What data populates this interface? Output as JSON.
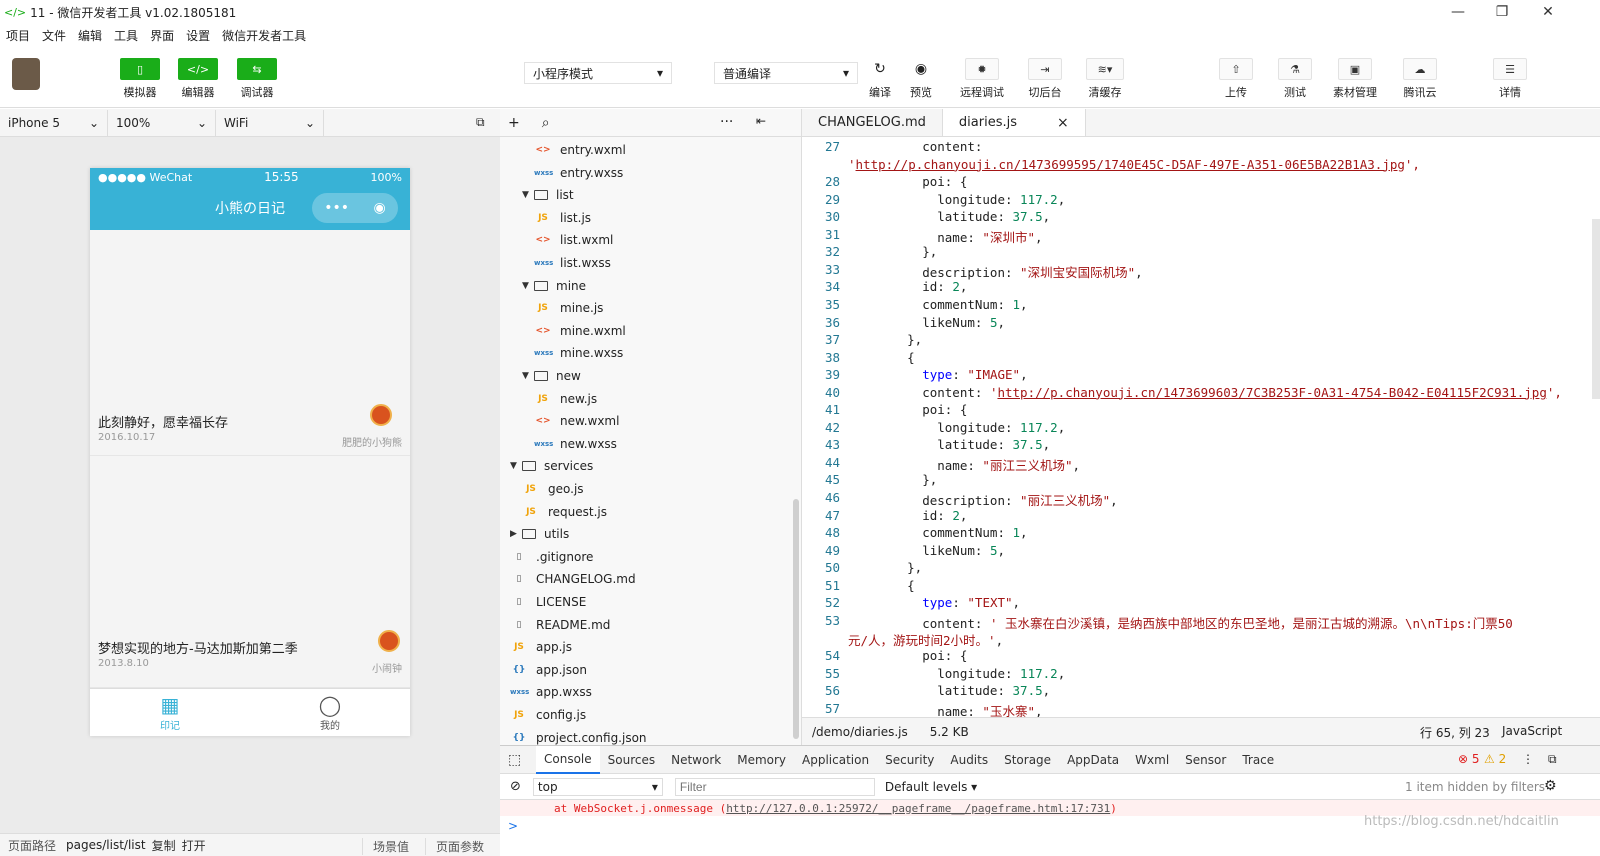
{
  "window": {
    "title": "11 - 微信开发者工具 v1.02.1805181",
    "minimize": "—",
    "maximize": "❐",
    "close": "✕"
  },
  "menu": [
    "项目",
    "文件",
    "编辑",
    "工具",
    "界面",
    "设置",
    "微信开发者工具"
  ],
  "toolbar": {
    "simulator": "模拟器",
    "editor": "编辑器",
    "debugger": "调试器",
    "mode_select": "小程序模式",
    "compile_select": "普通编译",
    "compile": "编译",
    "preview": "预览",
    "remote_debug": "远程调试",
    "background": "切后台",
    "clear_cache": "清缓存",
    "upload": "上传",
    "test": "测试",
    "assets": "素材管理",
    "tencent_cloud": "腾讯云",
    "details": "详情"
  },
  "device": {
    "model": "iPhone 5",
    "zoom": "100%",
    "network": "WiFi"
  },
  "phone": {
    "carrier": "●●●●● WeChat",
    "time": "15:55",
    "battery": "100%",
    "nav_title": "小熊の日记",
    "capsule_more": "•••",
    "capsule_close": "◉",
    "diaries": [
      {
        "title": "此刻静好，愿幸福长存",
        "date": "2016.10.17",
        "author": "肥肥的小狗熊"
      },
      {
        "title": "梦想实现的地方-马达加斯加第二季",
        "date": "2013.8.10",
        "author": "小闹钟"
      }
    ],
    "tabs": [
      {
        "label": "印记"
      },
      {
        "label": "我的"
      }
    ]
  },
  "bottom": {
    "path_label": "页面路径",
    "path": "pages/list/list",
    "copy": "复制",
    "open": "打开",
    "scene": "场景值",
    "params": "页面参数"
  },
  "tree": {
    "add": "+",
    "search": "⌕",
    "more": "···",
    "collapse": "⇤",
    "rows": [
      {
        "kind": "wxml",
        "name": "entry.wxml",
        "ft": "<>",
        "indent": 2
      },
      {
        "kind": "wxss",
        "name": "entry.wxss",
        "ft": "wxss",
        "indent": 2
      },
      {
        "kind": "folder",
        "name": "list",
        "ft": "",
        "indent": 1,
        "caret": "▼"
      },
      {
        "kind": "js",
        "name": "list.js",
        "ft": "JS",
        "indent": 2
      },
      {
        "kind": "wxml",
        "name": "list.wxml",
        "ft": "<>",
        "indent": 2
      },
      {
        "kind": "wxss",
        "name": "list.wxss",
        "ft": "wxss",
        "indent": 2
      },
      {
        "kind": "folder",
        "name": "mine",
        "ft": "",
        "indent": 1,
        "caret": "▼"
      },
      {
        "kind": "js",
        "name": "mine.js",
        "ft": "JS",
        "indent": 2
      },
      {
        "kind": "wxml",
        "name": "mine.wxml",
        "ft": "<>",
        "indent": 2
      },
      {
        "kind": "wxss",
        "name": "mine.wxss",
        "ft": "wxss",
        "indent": 2
      },
      {
        "kind": "folder",
        "name": "new",
        "ft": "",
        "indent": 1,
        "caret": "▼"
      },
      {
        "kind": "js",
        "name": "new.js",
        "ft": "JS",
        "indent": 2
      },
      {
        "kind": "wxml",
        "name": "new.wxml",
        "ft": "<>",
        "indent": 2
      },
      {
        "kind": "wxss",
        "name": "new.wxss",
        "ft": "wxss",
        "indent": 2
      },
      {
        "kind": "folder",
        "name": "services",
        "ft": "",
        "indent": 0,
        "caret": "▼"
      },
      {
        "kind": "js",
        "name": "geo.js",
        "ft": "JS",
        "indent": 1
      },
      {
        "kind": "js",
        "name": "request.js",
        "ft": "JS",
        "indent": 1
      },
      {
        "kind": "folder",
        "name": "utils",
        "ft": "",
        "indent": 0,
        "caret": "▶"
      },
      {
        "kind": "file",
        "name": ".gitignore",
        "ft": "▯",
        "indent": 0
      },
      {
        "kind": "file",
        "name": "CHANGELOG.md",
        "ft": "▯",
        "indent": 0
      },
      {
        "kind": "file",
        "name": "LICENSE",
        "ft": "▯",
        "indent": 0
      },
      {
        "kind": "file",
        "name": "README.md",
        "ft": "▯",
        "indent": 0
      },
      {
        "kind": "js",
        "name": "app.js",
        "ft": "JS",
        "indent": 0
      },
      {
        "kind": "json",
        "name": "app.json",
        "ft": "{}",
        "indent": 0
      },
      {
        "kind": "wxss",
        "name": "app.wxss",
        "ft": "wxss",
        "indent": 0
      },
      {
        "kind": "js",
        "name": "config.js",
        "ft": "JS",
        "indent": 0
      },
      {
        "kind": "json",
        "name": "project.config.json",
        "ft": "{}",
        "indent": 0
      }
    ]
  },
  "editor": {
    "tabs": [
      {
        "label": "CHANGELOG.md"
      },
      {
        "label": "diaries.js",
        "active": true,
        "close": "×"
      }
    ],
    "lines": [
      {
        "n": "27",
        "parts": [
          [
            "",
            "        content: "
          ]
        ]
      },
      {
        "n": "",
        "parts": [
          [
            "s",
            "'"
          ],
          [
            "u",
            "http://p.chanyouji.cn/1473699595/1740E45C-D5AF-497E-A351-06E5BA22B1A3.jpg"
          ],
          [
            "s",
            "',"
          ]
        ]
      },
      {
        "n": "28",
        "parts": [
          [
            "",
            "        poi: {"
          ]
        ]
      },
      {
        "n": "29",
        "parts": [
          [
            "",
            "          longitude: "
          ],
          [
            "n",
            "117.2"
          ],
          [
            "",
            ","
          ]
        ]
      },
      {
        "n": "30",
        "parts": [
          [
            "",
            "          latitude: "
          ],
          [
            "n",
            "37.5"
          ],
          [
            "",
            ","
          ]
        ]
      },
      {
        "n": "31",
        "parts": [
          [
            "",
            "          name: "
          ],
          [
            "s",
            "\"深圳市\""
          ],
          [
            "",
            ","
          ]
        ]
      },
      {
        "n": "32",
        "parts": [
          [
            "",
            "        },"
          ]
        ]
      },
      {
        "n": "33",
        "parts": [
          [
            "",
            "        description: "
          ],
          [
            "s",
            "\"深圳宝安国际机场\""
          ],
          [
            "",
            ","
          ]
        ]
      },
      {
        "n": "34",
        "parts": [
          [
            "",
            "        id: "
          ],
          [
            "n",
            "2"
          ],
          [
            "",
            ","
          ]
        ]
      },
      {
        "n": "35",
        "parts": [
          [
            "",
            "        commentNum: "
          ],
          [
            "n",
            "1"
          ],
          [
            "",
            ","
          ]
        ]
      },
      {
        "n": "36",
        "parts": [
          [
            "",
            "        likeNum: "
          ],
          [
            "n",
            "5"
          ],
          [
            "",
            ","
          ]
        ]
      },
      {
        "n": "37",
        "parts": [
          [
            "",
            "      },"
          ]
        ]
      },
      {
        "n": "38",
        "parts": [
          [
            "",
            "      {"
          ]
        ]
      },
      {
        "n": "39",
        "parts": [
          [
            "",
            "        "
          ],
          [
            "k",
            "type"
          ],
          [
            "",
            ": "
          ],
          [
            "s",
            "\"IMAGE\""
          ],
          [
            "",
            ","
          ]
        ]
      },
      {
        "n": "40",
        "parts": [
          [
            "",
            "        content: "
          ],
          [
            "s",
            "'"
          ],
          [
            "u",
            "http://p.chanyouji.cn/1473699603/7C3B253F-0A31-4754-B042-E04115F2C931.jpg"
          ],
          [
            "s",
            "',"
          ]
        ]
      },
      {
        "n": "41",
        "parts": [
          [
            "",
            "        poi: {"
          ]
        ]
      },
      {
        "n": "42",
        "parts": [
          [
            "",
            "          longitude: "
          ],
          [
            "n",
            "117.2"
          ],
          [
            "",
            ","
          ]
        ]
      },
      {
        "n": "43",
        "parts": [
          [
            "",
            "          latitude: "
          ],
          [
            "n",
            "37.5"
          ],
          [
            "",
            ","
          ]
        ]
      },
      {
        "n": "44",
        "parts": [
          [
            "",
            "          name: "
          ],
          [
            "s",
            "\"丽江三义机场\""
          ],
          [
            "",
            ","
          ]
        ]
      },
      {
        "n": "45",
        "parts": [
          [
            "",
            "        },"
          ]
        ]
      },
      {
        "n": "46",
        "parts": [
          [
            "",
            "        description: "
          ],
          [
            "s",
            "\"丽江三义机场\""
          ],
          [
            "",
            ","
          ]
        ]
      },
      {
        "n": "47",
        "parts": [
          [
            "",
            "        id: "
          ],
          [
            "n",
            "2"
          ],
          [
            "",
            ","
          ]
        ]
      },
      {
        "n": "48",
        "parts": [
          [
            "",
            "        commentNum: "
          ],
          [
            "n",
            "1"
          ],
          [
            "",
            ","
          ]
        ]
      },
      {
        "n": "49",
        "parts": [
          [
            "",
            "        likeNum: "
          ],
          [
            "n",
            "5"
          ],
          [
            "",
            ","
          ]
        ]
      },
      {
        "n": "50",
        "parts": [
          [
            "",
            "      },"
          ]
        ]
      },
      {
        "n": "51",
        "parts": [
          [
            "",
            "      {"
          ]
        ]
      },
      {
        "n": "52",
        "parts": [
          [
            "",
            "        "
          ],
          [
            "k",
            "type"
          ],
          [
            "",
            ": "
          ],
          [
            "s",
            "\"TEXT\""
          ],
          [
            "",
            ","
          ]
        ]
      },
      {
        "n": "53",
        "parts": [
          [
            "",
            "        content: "
          ],
          [
            "s",
            "' 玉水寨在白沙溪镇，是纳西族中部地区的东巴圣地，是丽江古城的溯源。\\n\\nTips:门票50"
          ]
        ]
      },
      {
        "n": "",
        "parts": [
          [
            "s",
            "元/人，游玩时间2小时。'"
          ],
          [
            "",
            ","
          ]
        ]
      },
      {
        "n": "54",
        "parts": [
          [
            "",
            "        poi: {"
          ]
        ]
      },
      {
        "n": "55",
        "parts": [
          [
            "",
            "          longitude: "
          ],
          [
            "n",
            "117.2"
          ],
          [
            "",
            ","
          ]
        ]
      },
      {
        "n": "56",
        "parts": [
          [
            "",
            "          latitude: "
          ],
          [
            "n",
            "37.5"
          ],
          [
            "",
            ","
          ]
        ]
      },
      {
        "n": "57",
        "parts": [
          [
            "",
            "          name: "
          ],
          [
            "s",
            "\"玉水寨\""
          ],
          [
            "",
            ","
          ]
        ]
      }
    ],
    "status": {
      "path": "/demo/diaries.js",
      "size": "5.2 KB",
      "cursor": "行 65, 列 23",
      "lang": "JavaScript"
    }
  },
  "devtools": {
    "tabs": [
      "Console",
      "Sources",
      "Network",
      "Memory",
      "Application",
      "Security",
      "Audits",
      "Storage",
      "AppData",
      "Wxml",
      "Sensor",
      "Trace"
    ],
    "errors": "5",
    "warnings": "2",
    "context": "top",
    "filter_placeholder": "Filter",
    "levels": "Default levels ▾",
    "hidden": "1 item hidden by filters",
    "log": [
      {
        "pre": "at WebSocket.j.onmessage (",
        "link": "http://127.0.0.1:25972/__pageframe__/pageframe.html:17:731",
        "post": ")"
      }
    ],
    "prompt": ">"
  },
  "watermark": "https://blog.csdn.net/hdcaitlin"
}
